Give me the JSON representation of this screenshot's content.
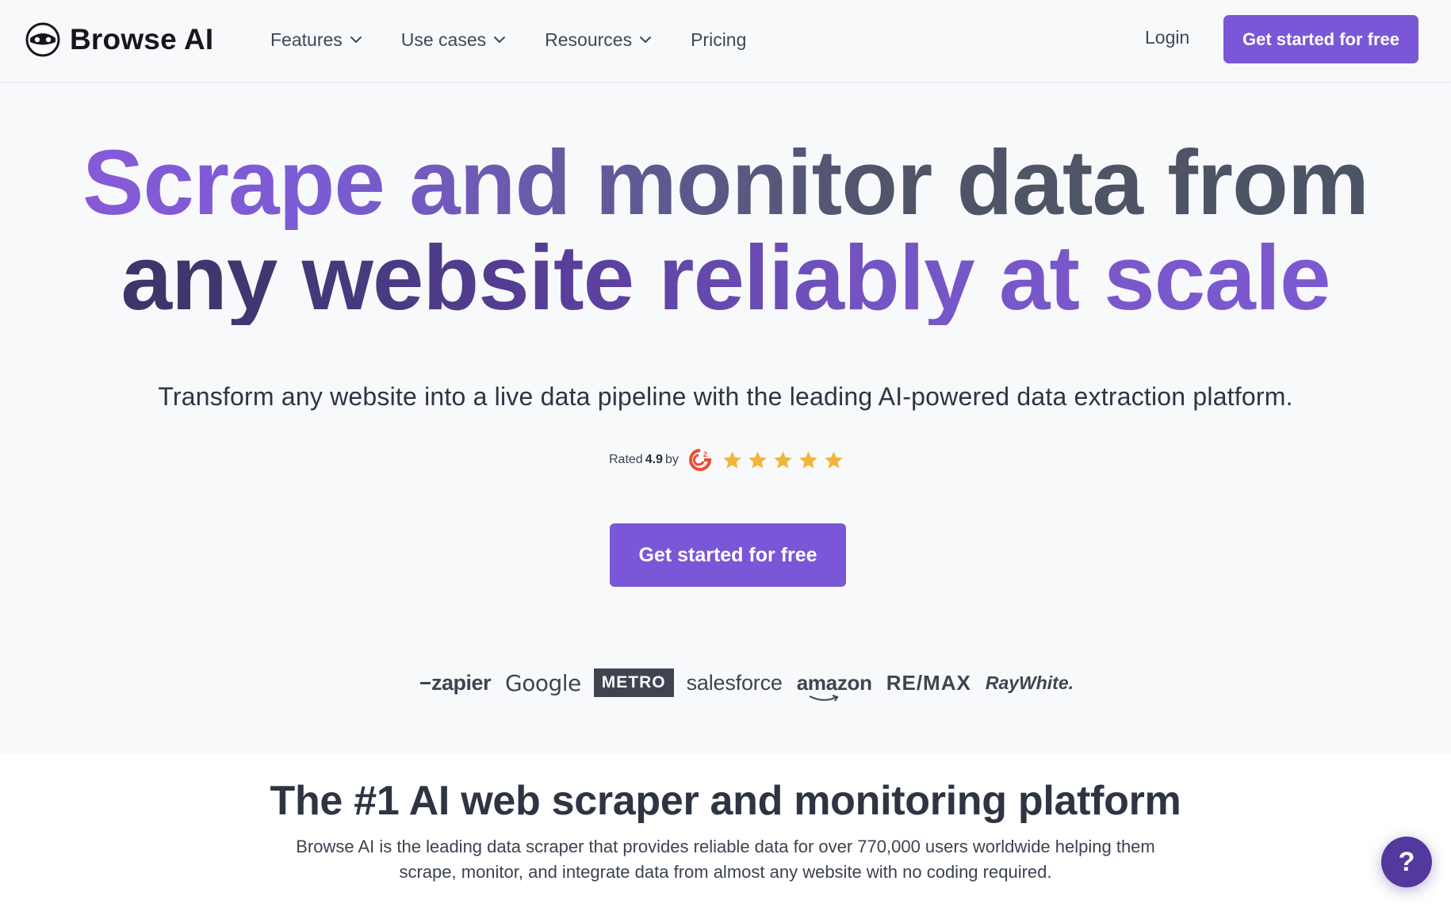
{
  "header": {
    "brand": "Browse AI",
    "nav": [
      {
        "label": "Features",
        "has_dropdown": true
      },
      {
        "label": "Use cases",
        "has_dropdown": true
      },
      {
        "label": "Resources",
        "has_dropdown": true
      },
      {
        "label": "Pricing",
        "has_dropdown": false
      }
    ],
    "login_label": "Login",
    "cta_label": "Get started for free"
  },
  "hero": {
    "headline_line1": "Scrape and monitor data from",
    "headline_line2": "any website reliably at scale",
    "subtitle": "Transform any website into a live data pipeline with the leading AI-powered data extraction platform.",
    "rating": {
      "prefix": "Rated",
      "score": "4.9",
      "suffix": "by",
      "source_icon": "g2-icon",
      "stars": 5
    },
    "cta_label": "Get started for free"
  },
  "customer_logos": [
    {
      "name": "zapier",
      "text": "zapier"
    },
    {
      "name": "google",
      "text": "Google"
    },
    {
      "name": "metro",
      "text": "METRO"
    },
    {
      "name": "salesforce",
      "text": "salesforce"
    },
    {
      "name": "amazon",
      "text": "amazon"
    },
    {
      "name": "remax",
      "text": "RE/MAX"
    },
    {
      "name": "raywhite",
      "text": "RayWhite."
    }
  ],
  "section2": {
    "title": "The #1 AI web scraper and monitoring platform",
    "body": "Browse AI is the leading data scraper that provides reliable data for over 770,000 users worldwide helping them scrape, monitor, and integrate data from almost any website with no coding required."
  },
  "help_button": {
    "label": "?"
  },
  "colors": {
    "accent": "#7a57d6",
    "accent_dark": "#51399e",
    "star": "#f2b53b",
    "text": "#343a4a",
    "background": "#f8f9fb"
  }
}
